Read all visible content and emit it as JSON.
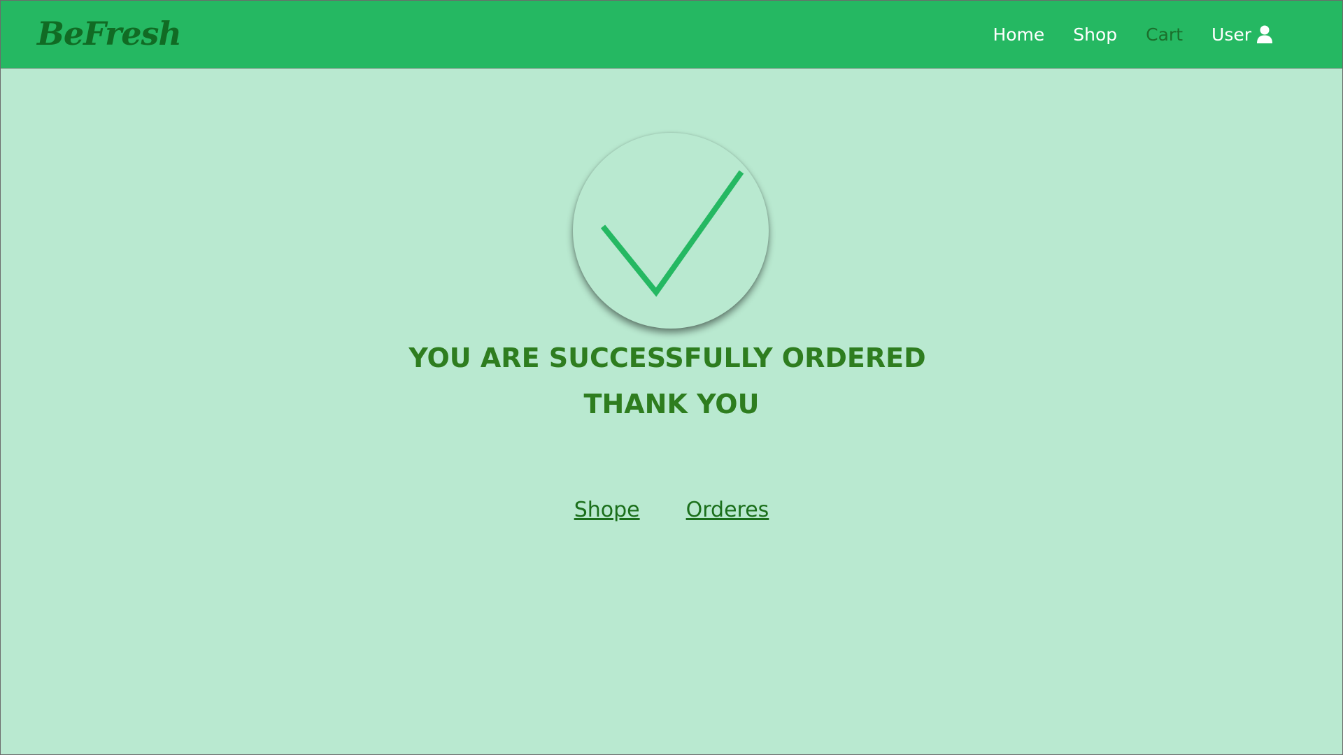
{
  "navbar": {
    "brand": "BeFresh",
    "links": [
      {
        "label": "Home",
        "active": false
      },
      {
        "label": "Shop",
        "active": false
      },
      {
        "label": "Cart",
        "active": true
      },
      {
        "label": "User",
        "icon": "user-icon",
        "active": false
      }
    ]
  },
  "confirmation": {
    "icon": "checkmark-icon",
    "title_line1": "YOU ARE SUCCESSFULLY ORDERED",
    "title_line2": "THANK YOU"
  },
  "actions": {
    "shop_label": "Shope",
    "orders_label": "Orderes"
  },
  "colors": {
    "navbar_bg": "#25b862",
    "page_bg": "#b9e9d0",
    "brand_text": "#116b24",
    "check_stroke": "#25b862",
    "heading_text": "#2e7d1f",
    "link_text": "#1b6f1b"
  }
}
